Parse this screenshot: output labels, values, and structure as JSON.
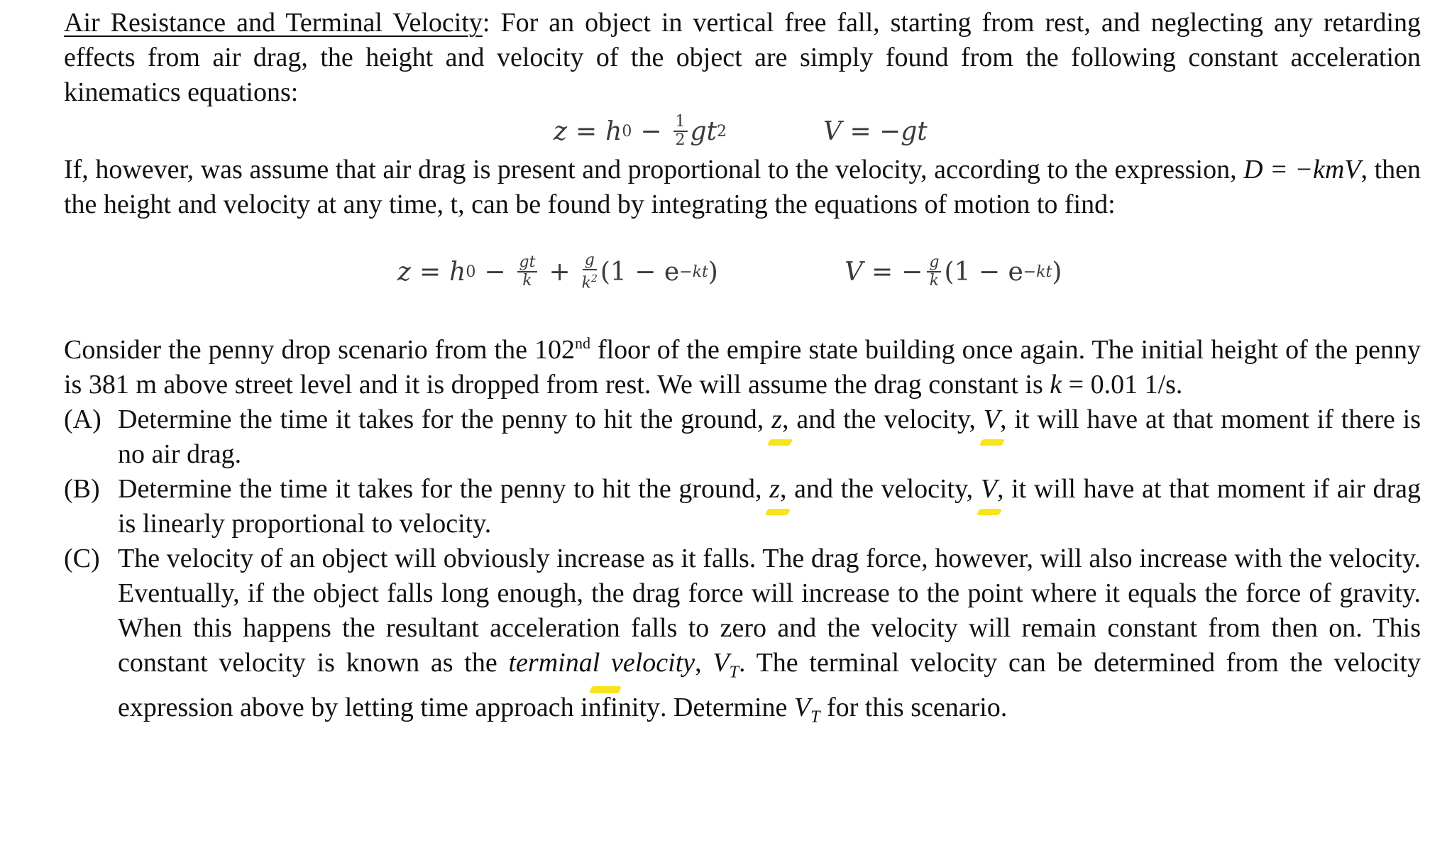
{
  "document": {
    "title": "Air Resistance and Terminal Velocity",
    "intro_after_title": ": For an object in vertical free fall, starting from rest, and neglecting any retarding effects from air drag, the height and velocity of the object are simply found from the following constant acceleration kinematics equations:",
    "eq_nodrag": {
      "z_lhs": "z",
      "h0": "h",
      "h0_sub": "0",
      "half_num": "1",
      "half_den": "2",
      "gt2": "gt",
      "gt2_exp": "2",
      "v_eq": "V = −gt"
    },
    "para2_a": "If, however, was assume that air drag is present and proportional to the velocity, according to the expression, ",
    "para2_expr_D": "D =",
    "para2_expr_kmV": "−kmV",
    "para2_b": ", then the height and velocity at any time, t, can be found by integrating the equations of motion to find:",
    "eq_drag": {
      "z_lhs": "z",
      "h0": "h",
      "h0_sub": "0",
      "frac1_num": "gt",
      "frac1_den": "k",
      "frac2_num": "g",
      "frac2_den": "k",
      "frac2_den_exp": "2",
      "paren": "(1 − e",
      "exp": "−kt",
      "close": ")",
      "v_lhs": "V",
      "v_frac_num": "g",
      "v_frac_den": "k"
    },
    "para3_a": "Consider the penny drop scenario from the 102",
    "para3_sup": "nd",
    "para3_b": " floor of the empire state building once again. The initial height of the penny is 381 m above street level and it is dropped from rest. We will assume the drag constant is ",
    "para3_k": "k",
    "para3_c": " = 0.01 1/s.",
    "items": [
      {
        "label": "(A)",
        "text_a": "Determine the time it takes for the penny to hit the ground, ",
        "z": "z",
        "text_b": ", and the velocity, ",
        "v": "V",
        "text_c": ", it will have at that moment if there is no air drag."
      },
      {
        "label": "(B)",
        "text_a": "Determine the time it takes for the penny to hit the ground, ",
        "z": "z",
        "text_b": ", and the velocity, ",
        "v": "V",
        "text_c": ", it will have at that moment if air drag is linearly proportional to velocity."
      },
      {
        "label": "(C)",
        "text_a": "The velocity of an object will obviously increase as it falls. The drag force, however, will also increase with the velocity. Eventually, if the object falls long enough, the drag force will increase to the point where it equals the force of gravity. When this happens the resultant acceleration falls to zero and the velocity will remain constant from then on. This constant velocity is known as the ",
        "term": "terminal velocity",
        "vt": "V",
        "vt_sub": "T",
        "text_b": ". The terminal velocity can be determined from the velocity expression above by letting time approach ",
        "infinity": "infinity",
        "text_c": ". Determine ",
        "vt2": "V",
        "vt2_sub": "T",
        "text_d": " for this scenario."
      }
    ],
    "highlight_color": "#f7e41a"
  }
}
